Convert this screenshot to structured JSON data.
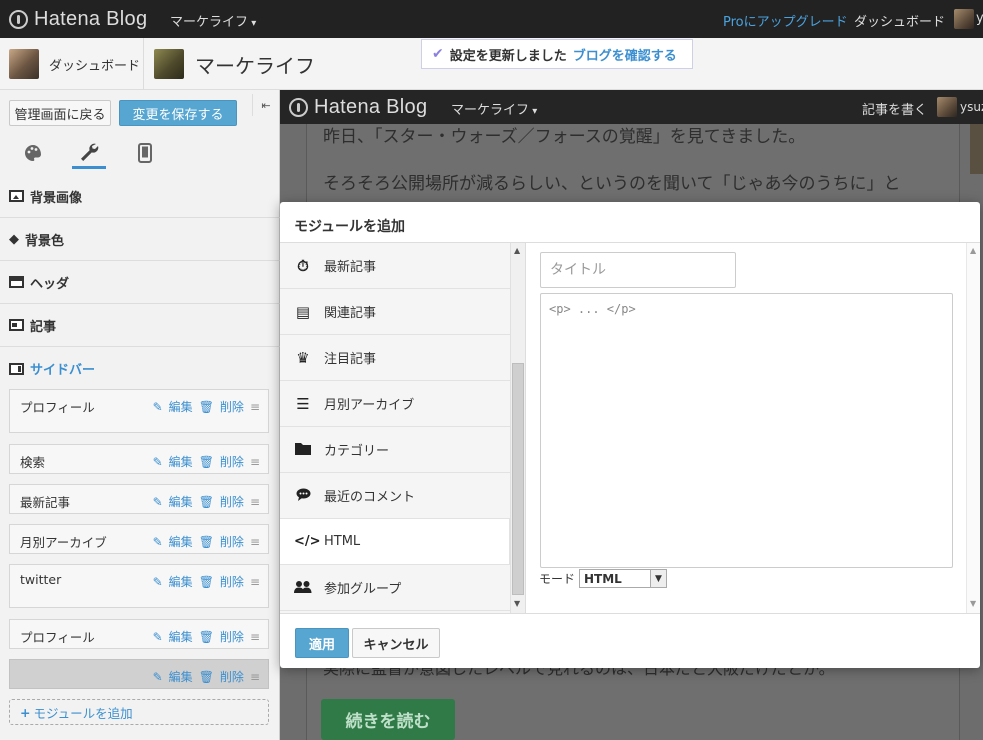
{
  "topbar": {
    "logo": "Hatena Blog",
    "blog_menu": "マーケライフ",
    "pro_link": "Proにアップグレード",
    "dashboard_link": "ダッシュボード",
    "user_truncated": "y"
  },
  "secondbar": {
    "dashboard_label": "ダッシュボード",
    "blog_title": "マーケライフ"
  },
  "toast": {
    "message": "設定を更新しました",
    "link": "ブログを確認する"
  },
  "leftpanel": {
    "back_button": "管理画面に戻る",
    "save_button": "変更を保存する",
    "collapse_icon": "⇤",
    "sections": {
      "bg_image": "背景画像",
      "bg_color": "背景色",
      "header": "ヘッダ",
      "post": "記事",
      "sidebar": "サイドバー"
    },
    "widgets": [
      {
        "name": "プロフィール"
      },
      {
        "name": "検索"
      },
      {
        "name": "最新記事"
      },
      {
        "name": "月別アーカイブ"
      },
      {
        "name": "twitter"
      },
      {
        "name": "プロフィール"
      },
      {
        "name": ""
      }
    ],
    "edit_label": "編集",
    "delete_label": "削除",
    "add_module": "モジュールを追加"
  },
  "preview": {
    "logo": "Hatena Blog",
    "blog_menu": "マーケライフ",
    "write_link": "記事を書く",
    "user_truncated": "ysuz",
    "line1": "昨日、「スター・ウォーズ／フォースの覚醒」を見てきました。",
    "line2": "そろそろ公開場所が減るらしい、というのを聞いて「じゃあ今のうちに」と",
    "line3": "実際に監督が意図したレベルで見れるのは、日本だと大阪だけだとか。",
    "read_more": "続きを読む"
  },
  "modal": {
    "title": "モジュールを追加",
    "items": [
      {
        "label": "最新記事",
        "icon": "stopwatch-icon"
      },
      {
        "label": "関連記事",
        "icon": "article-icon"
      },
      {
        "label": "注目記事",
        "icon": "crown-icon"
      },
      {
        "label": "月別アーカイブ",
        "icon": "list-icon"
      },
      {
        "label": "カテゴリー",
        "icon": "folder-icon"
      },
      {
        "label": "最近のコメント",
        "icon": "comment-icon"
      },
      {
        "label": "HTML",
        "icon": "code-icon"
      },
      {
        "label": "参加グループ",
        "icon": "group-icon"
      }
    ],
    "selected_index": 6,
    "title_placeholder": "タイトル",
    "code_placeholder": "<p> ... </p>",
    "mode_label": "モード",
    "mode_value": "HTML",
    "apply_button": "適用",
    "cancel_button": "キャンセル"
  },
  "colors": {
    "accent_blue": "#3b8fd0",
    "save_blue": "#56a6d1",
    "topbar_bg": "#222222",
    "read_more_green": "#2f7a47"
  }
}
